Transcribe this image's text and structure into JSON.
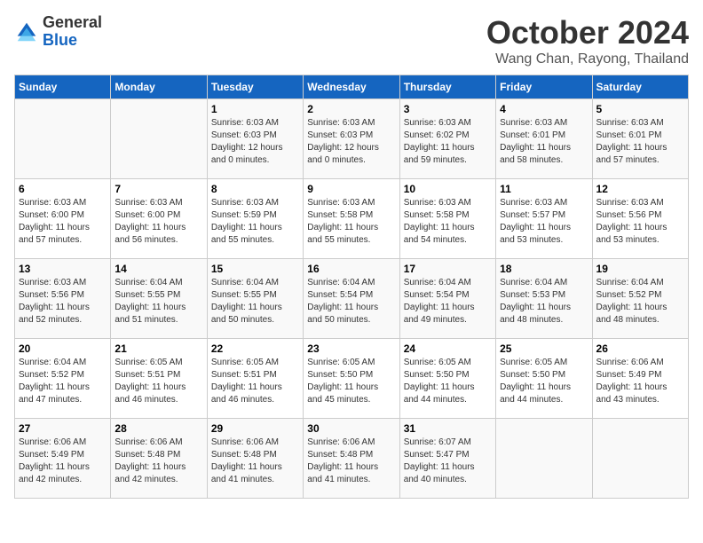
{
  "header": {
    "logo_general": "General",
    "logo_blue": "Blue",
    "month": "October 2024",
    "location": "Wang Chan, Rayong, Thailand"
  },
  "days_of_week": [
    "Sunday",
    "Monday",
    "Tuesday",
    "Wednesday",
    "Thursday",
    "Friday",
    "Saturday"
  ],
  "weeks": [
    [
      {
        "day": "",
        "info": ""
      },
      {
        "day": "",
        "info": ""
      },
      {
        "day": "1",
        "info": "Sunrise: 6:03 AM\nSunset: 6:03 PM\nDaylight: 12 hours\nand 0 minutes."
      },
      {
        "day": "2",
        "info": "Sunrise: 6:03 AM\nSunset: 6:03 PM\nDaylight: 12 hours\nand 0 minutes."
      },
      {
        "day": "3",
        "info": "Sunrise: 6:03 AM\nSunset: 6:02 PM\nDaylight: 11 hours\nand 59 minutes."
      },
      {
        "day": "4",
        "info": "Sunrise: 6:03 AM\nSunset: 6:01 PM\nDaylight: 11 hours\nand 58 minutes."
      },
      {
        "day": "5",
        "info": "Sunrise: 6:03 AM\nSunset: 6:01 PM\nDaylight: 11 hours\nand 57 minutes."
      }
    ],
    [
      {
        "day": "6",
        "info": "Sunrise: 6:03 AM\nSunset: 6:00 PM\nDaylight: 11 hours\nand 57 minutes."
      },
      {
        "day": "7",
        "info": "Sunrise: 6:03 AM\nSunset: 6:00 PM\nDaylight: 11 hours\nand 56 minutes."
      },
      {
        "day": "8",
        "info": "Sunrise: 6:03 AM\nSunset: 5:59 PM\nDaylight: 11 hours\nand 55 minutes."
      },
      {
        "day": "9",
        "info": "Sunrise: 6:03 AM\nSunset: 5:58 PM\nDaylight: 11 hours\nand 55 minutes."
      },
      {
        "day": "10",
        "info": "Sunrise: 6:03 AM\nSunset: 5:58 PM\nDaylight: 11 hours\nand 54 minutes."
      },
      {
        "day": "11",
        "info": "Sunrise: 6:03 AM\nSunset: 5:57 PM\nDaylight: 11 hours\nand 53 minutes."
      },
      {
        "day": "12",
        "info": "Sunrise: 6:03 AM\nSunset: 5:56 PM\nDaylight: 11 hours\nand 53 minutes."
      }
    ],
    [
      {
        "day": "13",
        "info": "Sunrise: 6:03 AM\nSunset: 5:56 PM\nDaylight: 11 hours\nand 52 minutes."
      },
      {
        "day": "14",
        "info": "Sunrise: 6:04 AM\nSunset: 5:55 PM\nDaylight: 11 hours\nand 51 minutes."
      },
      {
        "day": "15",
        "info": "Sunrise: 6:04 AM\nSunset: 5:55 PM\nDaylight: 11 hours\nand 50 minutes."
      },
      {
        "day": "16",
        "info": "Sunrise: 6:04 AM\nSunset: 5:54 PM\nDaylight: 11 hours\nand 50 minutes."
      },
      {
        "day": "17",
        "info": "Sunrise: 6:04 AM\nSunset: 5:54 PM\nDaylight: 11 hours\nand 49 minutes."
      },
      {
        "day": "18",
        "info": "Sunrise: 6:04 AM\nSunset: 5:53 PM\nDaylight: 11 hours\nand 48 minutes."
      },
      {
        "day": "19",
        "info": "Sunrise: 6:04 AM\nSunset: 5:52 PM\nDaylight: 11 hours\nand 48 minutes."
      }
    ],
    [
      {
        "day": "20",
        "info": "Sunrise: 6:04 AM\nSunset: 5:52 PM\nDaylight: 11 hours\nand 47 minutes."
      },
      {
        "day": "21",
        "info": "Sunrise: 6:05 AM\nSunset: 5:51 PM\nDaylight: 11 hours\nand 46 minutes."
      },
      {
        "day": "22",
        "info": "Sunrise: 6:05 AM\nSunset: 5:51 PM\nDaylight: 11 hours\nand 46 minutes."
      },
      {
        "day": "23",
        "info": "Sunrise: 6:05 AM\nSunset: 5:50 PM\nDaylight: 11 hours\nand 45 minutes."
      },
      {
        "day": "24",
        "info": "Sunrise: 6:05 AM\nSunset: 5:50 PM\nDaylight: 11 hours\nand 44 minutes."
      },
      {
        "day": "25",
        "info": "Sunrise: 6:05 AM\nSunset: 5:50 PM\nDaylight: 11 hours\nand 44 minutes."
      },
      {
        "day": "26",
        "info": "Sunrise: 6:06 AM\nSunset: 5:49 PM\nDaylight: 11 hours\nand 43 minutes."
      }
    ],
    [
      {
        "day": "27",
        "info": "Sunrise: 6:06 AM\nSunset: 5:49 PM\nDaylight: 11 hours\nand 42 minutes."
      },
      {
        "day": "28",
        "info": "Sunrise: 6:06 AM\nSunset: 5:48 PM\nDaylight: 11 hours\nand 42 minutes."
      },
      {
        "day": "29",
        "info": "Sunrise: 6:06 AM\nSunset: 5:48 PM\nDaylight: 11 hours\nand 41 minutes."
      },
      {
        "day": "30",
        "info": "Sunrise: 6:06 AM\nSunset: 5:48 PM\nDaylight: 11 hours\nand 41 minutes."
      },
      {
        "day": "31",
        "info": "Sunrise: 6:07 AM\nSunset: 5:47 PM\nDaylight: 11 hours\nand 40 minutes."
      },
      {
        "day": "",
        "info": ""
      },
      {
        "day": "",
        "info": ""
      }
    ]
  ]
}
